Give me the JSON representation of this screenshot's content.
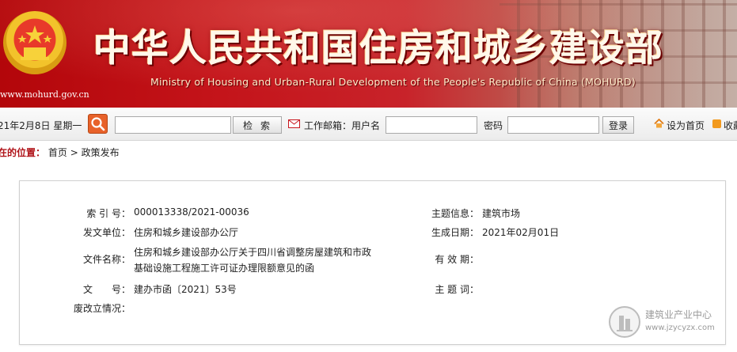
{
  "banner": {
    "title": "中华人民共和国住房和城乡建设部",
    "subtitle_en": "Ministry of Housing and Urban-Rural Development of the People's Republic of China (MOHURD)",
    "url": "www.mohurd.gov.cn",
    "emblem_icon": "national-emblem"
  },
  "toolbar": {
    "date": "21年2月8日 星期一",
    "search_icon": "magnifier-icon",
    "search_placeholder": "",
    "search_button": "检索",
    "mail_label": "工作邮箱：用户名",
    "username_placeholder": "",
    "password_label": "密码",
    "password_placeholder": "",
    "login_button": "登录",
    "homepage_label": "设为首页",
    "favorite_label": "收藏"
  },
  "breadcrumb": {
    "prefix": "在的位置：",
    "home": "首页",
    "separator": ">",
    "current": "政策发布"
  },
  "info": {
    "index_label": "索 引 号：",
    "index_value": "000013338/2021-00036",
    "topic_label": "主题信息：",
    "topic_value": "建筑市场",
    "issuer_label": "发文单位：",
    "issuer_value": "住房和城乡建设部办公厅",
    "date_label": "生成日期：",
    "date_value": "2021年02月01日",
    "filename_label": "文件名称：",
    "filename_line1": "住房和城乡建设部办公厅关于四川省调整房屋建筑和市政",
    "filename_line2": "基础设施工程施工许可证办理限额意见的函",
    "validity_label": "有 效 期：",
    "validity_value": "",
    "docno_label": "文　　号：",
    "docno_value": "建办市函〔2021〕53号",
    "keywords_label": "主 题 词：",
    "keywords_value": "",
    "status_label": "废改立情况：",
    "status_value": ""
  },
  "watermark": {
    "name": "建筑业产业中心",
    "url": "www.jzycyzx.com"
  },
  "colors": {
    "banner_red": "#c4141a",
    "breadcrumb_red": "#b0141a",
    "search_orange": "#e8622a"
  }
}
